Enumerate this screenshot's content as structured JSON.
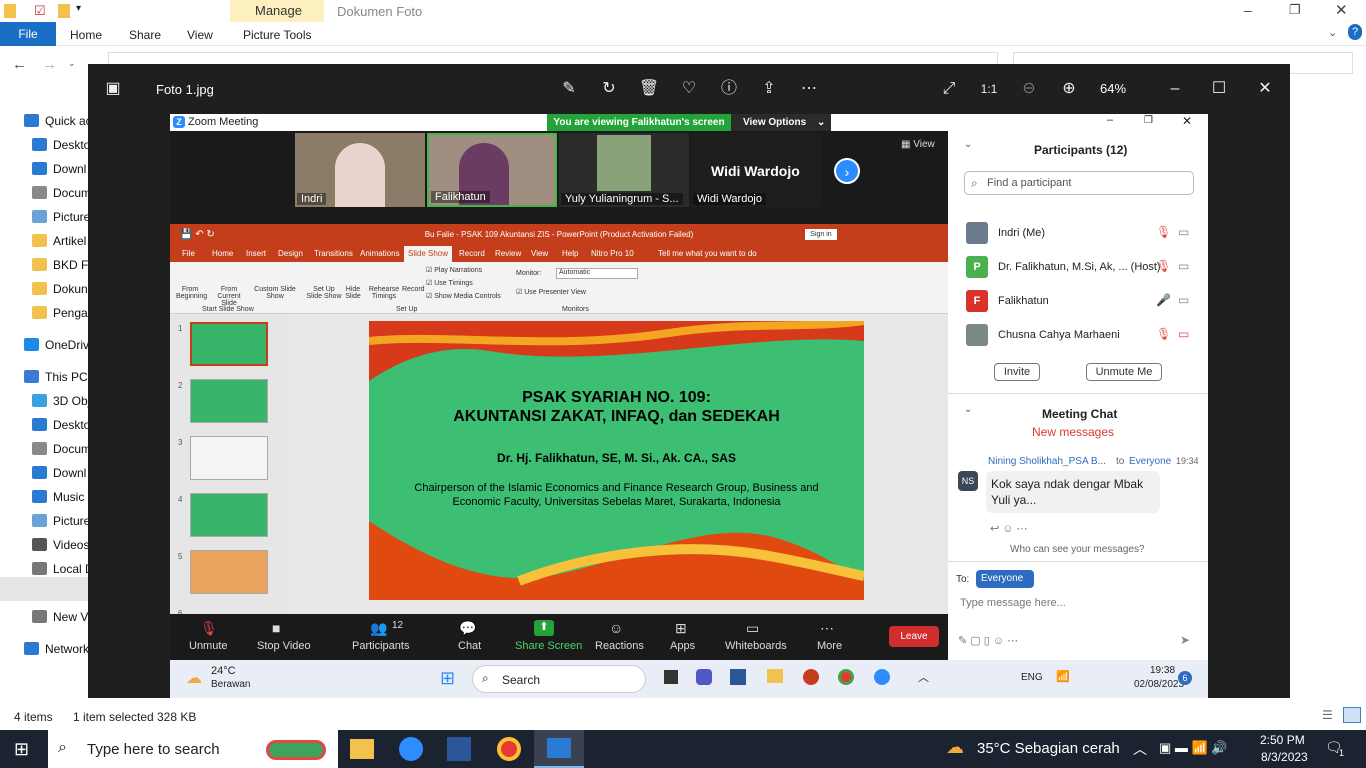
{
  "explorer": {
    "title": "Dokumen Foto",
    "manage_label": "Manage",
    "ribbon_tabs": [
      "File",
      "Home",
      "Share",
      "View",
      "Picture Tools"
    ],
    "sidebar": [
      {
        "label": "Quick ac",
        "color": "#2a7ad3"
      },
      {
        "label": "Deskto",
        "color": "#2a7ad3"
      },
      {
        "label": "Downl",
        "color": "#2a7ad3"
      },
      {
        "label": "Docum",
        "color": "#8a8a8a"
      },
      {
        "label": "Picture",
        "color": "#6aa2d8"
      },
      {
        "label": "Artikel",
        "color": "#f2c14e"
      },
      {
        "label": "BKD Fe",
        "color": "#f2c14e"
      },
      {
        "label": "Dokun",
        "color": "#f2c14e"
      },
      {
        "label": "Pengal",
        "color": "#f2c14e"
      },
      {
        "label": "OneDriv",
        "color": "#1e8ae8"
      },
      {
        "label": "This PC",
        "color": "#3a7bd5"
      },
      {
        "label": "3D Obj",
        "color": "#3aa0e0"
      },
      {
        "label": "Deskto",
        "color": "#2a7ad3"
      },
      {
        "label": "Docum",
        "color": "#8a8a8a"
      },
      {
        "label": "Downl",
        "color": "#2a7ad3"
      },
      {
        "label": "Music",
        "color": "#2a7ad3"
      },
      {
        "label": "Picture",
        "color": "#6aa2d8"
      },
      {
        "label": "Videos",
        "color": "#555"
      },
      {
        "label": "Local D",
        "color": "#777"
      },
      {
        "label": "New Vo",
        "color": "#777"
      },
      {
        "label": "New Vo",
        "color": "#777"
      },
      {
        "label": "Network",
        "color": "#2a7ad3"
      }
    ],
    "status": {
      "items": "4 items",
      "selected": "1 item selected",
      "size": "328 KB"
    }
  },
  "photos": {
    "filename": "Foto 1.jpg",
    "zoom": "64%"
  },
  "zoom": {
    "window_title": "Zoom Meeting",
    "banner": "You are viewing Falikhatun's screen",
    "view_options": "View Options",
    "view_label": "View",
    "gallery": [
      {
        "name": "Indri",
        "bg": "#8a7c66"
      },
      {
        "name": "Falikhatun",
        "bg": "#a08e80"
      },
      {
        "name": "Yuly Yulianingrum - S...",
        "bg": "#2b2b2b"
      },
      {
        "name": "Widi Wardojo",
        "bg": "#1e1e1e"
      }
    ],
    "big_name": "Widi Wardojo",
    "ppt": {
      "title": "Bu Falie - PSAK 109 Akuntansi ZIS - PowerPoint (Product Activation Failed)",
      "signin": "Sign in",
      "tabs": [
        "File",
        "Home",
        "Insert",
        "Design",
        "Transitions",
        "Animations",
        "Slide Show",
        "Record",
        "Review",
        "View",
        "Help",
        "Nitro Pro 10",
        "Tell me what you want to do"
      ],
      "ribbon": {
        "from_beginning": "From Beginning",
        "from_current": "From Current Slide",
        "custom": "Custom Slide Show",
        "group1": "Start Slide Show",
        "setup": "Set Up Slide Show",
        "hide": "Hide Slide",
        "rehearse": "Rehearse Timings",
        "record": "Record",
        "play_narr": "Play Narrations",
        "use_timings": "Use Timings",
        "show_media": "Show Media Controls",
        "group2": "Set Up",
        "monitor_label": "Monitor:",
        "monitor_value": "Automatic",
        "presenter": "Use Presenter View",
        "group3": "Monitors"
      },
      "thumb_numbers": [
        "1",
        "2",
        "3",
        "4",
        "5",
        "6"
      ],
      "slide": {
        "line1": "PSAK SYARIAH NO. 109:",
        "line2": "AKUNTANSI ZAKAT, INFAQ, dan SEDEKAH",
        "author": "Dr. Hj. Falikhatun, SE, M. Si., Ak. CA., SAS",
        "affiliation": "Chairperson of the Islamic Economics and Finance Research Group, Business and Economic Faculty, Universitas Sebelas Maret, Surakarta,  Indonesia"
      }
    },
    "toolbar": [
      {
        "label": "Unmute"
      },
      {
        "label": "Stop Video"
      },
      {
        "label": "Participants",
        "count": "12"
      },
      {
        "label": "Chat"
      },
      {
        "label": "Share Screen"
      },
      {
        "label": "Reactions"
      },
      {
        "label": "Apps"
      },
      {
        "label": "Whiteboards"
      },
      {
        "label": "More"
      }
    ],
    "leave": "Leave",
    "panel": {
      "participants_title": "Participants (12)",
      "find_placeholder": "Find a participant",
      "participants": [
        {
          "name": "Indri (Me)",
          "initial": "",
          "color": "#6b7a8c",
          "mic": "muted",
          "cam": "on"
        },
        {
          "name": "Dr. Falikhatun, M.Si, Ak, ...  (Host)",
          "initial": "P",
          "color": "#4caf50",
          "mic": "muted",
          "cam": "on"
        },
        {
          "name": "Falikhatun",
          "initial": "F",
          "color": "#d9322b",
          "mic": "on",
          "cam": "on"
        },
        {
          "name": "Chusna Cahya Marhaeni",
          "initial": "",
          "color": "#7a8a80",
          "mic": "muted",
          "cam": "off"
        }
      ],
      "invite": "Invite",
      "unmute_me": "Unmute Me",
      "chat_title": "Meeting Chat",
      "new_messages": "New messages",
      "chat": {
        "sender": "Nining Sholikhah_PSA B...",
        "to_label": "to",
        "to": "Everyone",
        "time": "19:34",
        "initials": "NS",
        "message": "Kok saya ndak dengar Mbak Yuli ya..."
      },
      "who_can_see": "Who can see your messages?",
      "to_prefix": "To:",
      "to_value": "Everyone",
      "message_placeholder": "Type message here..."
    },
    "inner_taskbar": {
      "temp": "24°C",
      "weather": "Berawan",
      "search": "Search",
      "lang": "ENG",
      "time": "19:38",
      "date": "02/08/2023",
      "badge": "6"
    }
  },
  "taskbar": {
    "search_placeholder": "Type here to search",
    "weather": "35°C  Sebagian cerah",
    "time": "2:50 PM",
    "date": "8/3/2023",
    "notif": "1"
  }
}
